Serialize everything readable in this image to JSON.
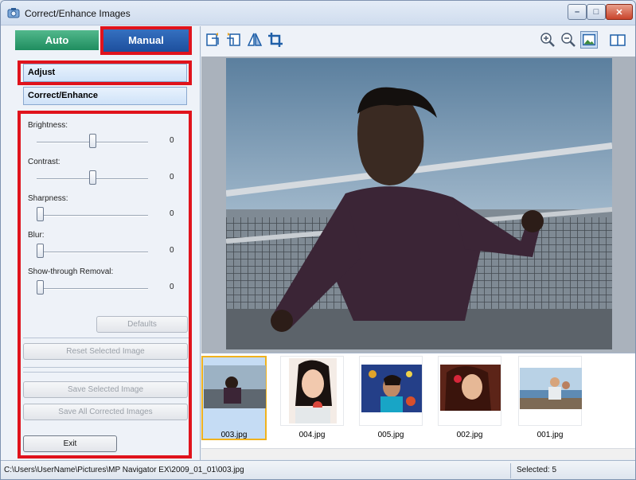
{
  "window": {
    "title": "Correct/Enhance Images",
    "min_glyph": "–",
    "max_glyph": "□",
    "close_glyph": "✕"
  },
  "mode_tabs": {
    "auto_label": "Auto",
    "manual_label": "Manual",
    "active": "Manual"
  },
  "menu": {
    "adjust_label": "Adjust",
    "correct_label": "Correct/Enhance"
  },
  "sliders": [
    {
      "label": "Brightness:",
      "value": "0",
      "level": 0.5
    },
    {
      "label": "Contrast:",
      "value": "0",
      "level": 0.5
    },
    {
      "label": "Sharpness:",
      "value": "0",
      "level": 0.0
    },
    {
      "label": "Blur:",
      "value": "0",
      "level": 0.0
    },
    {
      "label": "Show-through Removal:",
      "value": "0",
      "level": 0.0
    }
  ],
  "buttons": {
    "defaults": "Defaults",
    "reset_selected": "Reset Selected Image",
    "save_selected": "Save Selected Image",
    "save_all": "Save All Corrected Images",
    "exit": "Exit"
  },
  "toolbar": {
    "icons": [
      "rotate-left-icon",
      "rotate-right-icon",
      "flip-icon",
      "crop-icon",
      "zoom-in-icon",
      "zoom-out-icon",
      "full-image-icon",
      "compare-icon"
    ]
  },
  "thumbnails": [
    {
      "label": "003.jpg",
      "selected": true
    },
    {
      "label": "004.jpg",
      "selected": false
    },
    {
      "label": "005.jpg",
      "selected": false
    },
    {
      "label": "002.jpg",
      "selected": false
    },
    {
      "label": "001.jpg",
      "selected": false
    }
  ],
  "status": {
    "path": "C:\\Users\\UserName\\Pictures\\MP Navigator EX\\2009_01_01\\003.jpg",
    "selected": "Selected: 5"
  },
  "colors": {
    "highlight": "#e0131c",
    "auto_tab": "#1f8d5f",
    "manual_tab": "#1d4f9d",
    "selected_thumb_border": "#f0b21d"
  }
}
